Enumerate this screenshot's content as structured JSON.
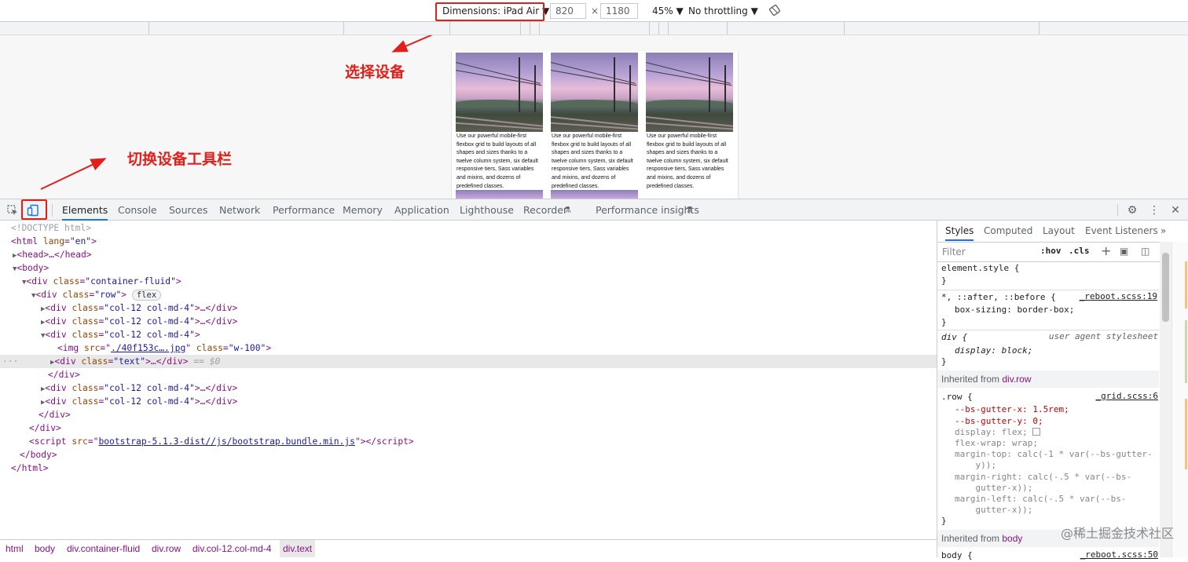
{
  "device_toolbar": {
    "dimensions_label": "Dimensions: iPad Air ▼",
    "width": "820",
    "times": "×",
    "height": "1180",
    "zoom": "45% ▼",
    "throttling": "No throttling ▼",
    "rotate_icon": "rotate-icon"
  },
  "annotations": {
    "select_device": "选择设备",
    "toggle_toolbar": "切换设备工具栏"
  },
  "device_cards": [
    {
      "text": "Use our powerful mobile-first flexbox grid to build layouts of all shapes and sizes thanks to a twelve column system, six default responsive tiers, Sass variables and mixins, and dozens of predefined classes."
    },
    {
      "text": "Use our powerful mobile-first flexbox grid to build layouts of all shapes and sizes thanks to a twelve column system, six default responsive tiers, Sass variables and mixins, and dozens of predefined classes."
    },
    {
      "text": "Use our powerful mobile-first flexbox grid to build layouts of all shapes and sizes thanks to a twelve column system, six default responsive tiers, Sass variables and mixins, and dozens of predefined classes."
    }
  ],
  "tabs": [
    "Elements",
    "Console",
    "Sources",
    "Network",
    "Performance",
    "Memory",
    "Application",
    "Lighthouse",
    "Recorder",
    "Performance insights"
  ],
  "dom": {
    "doctype": "<!DOCTYPE html>",
    "l_html_tag": "<html ",
    "l_html_attr": "lang",
    "l_html_val": "\"en\"",
    "l_head": "<head>…</head>",
    "l_body": "<body>",
    "l_cf_tag": "<div ",
    "l_cf_attr": "class",
    "l_cf_val": "\"container-fluid\"",
    "l_row_val": "\"row\"",
    "flex_badge": "flex",
    "col_val": "\"col-12 col-md-4\"",
    "ellipsis_close": "…</div>",
    "img_src_val": "./40f153c….jpg",
    "img_class_val": "\"w-100\"",
    "text_val": "\"text\"",
    "eq_dollar": "== $0",
    "close_div": "</div>",
    "close_body": "</body>",
    "close_html": "</html>",
    "script_src": "bootstrap-5.1.3-dist//js/bootstrap.bundle.min.js"
  },
  "breadcrumbs": [
    "html",
    "body",
    "div.container-fluid",
    "div.row",
    "div.col-12.col-md-4",
    "div.text"
  ],
  "styles": {
    "tabs": [
      "Styles",
      "Computed",
      "Layout",
      "Event Listeners",
      "»"
    ],
    "filter_placeholder": "Filter",
    "hov": ":hov",
    "cls": ".cls",
    "plus": "+",
    "element_style": "element.style {",
    "close_brace": "}",
    "universal_sel": "*, ::after, ::before {",
    "reboot_src": "_reboot.scss:19",
    "box_sizing": "box-sizing: border-box;",
    "div_sel": "div {",
    "ua_src": "user agent stylesheet",
    "display_block": "display: block;",
    "inherited_from": "Inherited from ",
    "inherited_row": "div.row",
    "row_sel": ".row {",
    "grid_src": "_grid.scss:6",
    "gutter_x": "--bs-gutter-x: 1.5rem;",
    "gutter_y": "--bs-gutter-y: 0;",
    "display_flex": "display: flex;",
    "flex_wrap": "flex-wrap: wrap;",
    "margin_top_1": "margin-top: calc(-1 * var(--bs-gutter-",
    "margin_top_2": "    y));",
    "margin_right_1": "margin-right: calc(-.5 * var(--bs-",
    "margin_right_2": "    gutter-x));",
    "margin_left_1": "margin-left: calc(-.5 * var(--bs-",
    "margin_left_2": "    gutter-x));",
    "inherited_body": "body",
    "body_sel": "body {",
    "body_src": "_reboot.scss:50"
  },
  "watermark": "@稀土掘金技术社区",
  "colors": {
    "annotation_red": "#e0201b",
    "tab_active": "#1a73e8",
    "tag": "#881280",
    "attr": "#994500",
    "value": "#1a1aa6"
  }
}
